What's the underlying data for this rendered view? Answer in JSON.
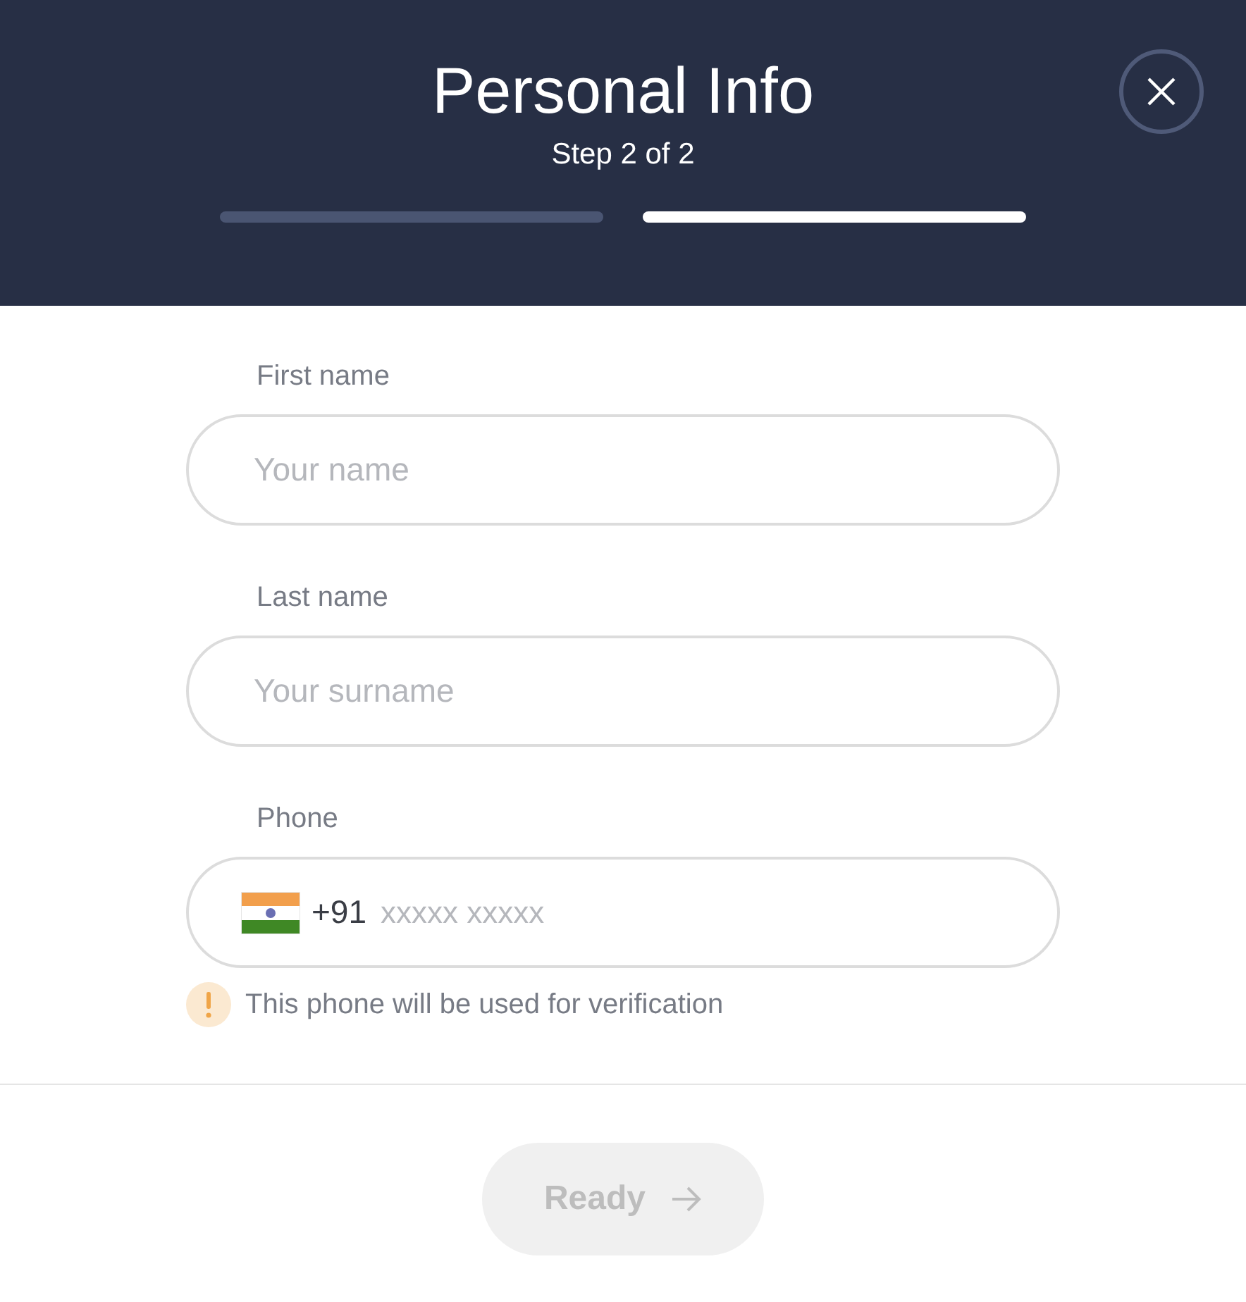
{
  "header": {
    "title": "Personal Info",
    "subtitle": "Step 2 of 2",
    "steps": [
      {
        "selected": false
      },
      {
        "selected": true
      }
    ]
  },
  "fields": [
    {
      "kind": "text",
      "label": "First name",
      "placeholder": "Your name"
    },
    {
      "kind": "text",
      "label": "Last name",
      "placeholder": "Your surname"
    },
    {
      "kind": "phone",
      "label": "Phone",
      "code": "+91",
      "placeholder": "xxxxx xxxxx",
      "note": "This phone will be used for verification"
    }
  ],
  "button": {
    "label": "Ready",
    "disabled": true
  }
}
